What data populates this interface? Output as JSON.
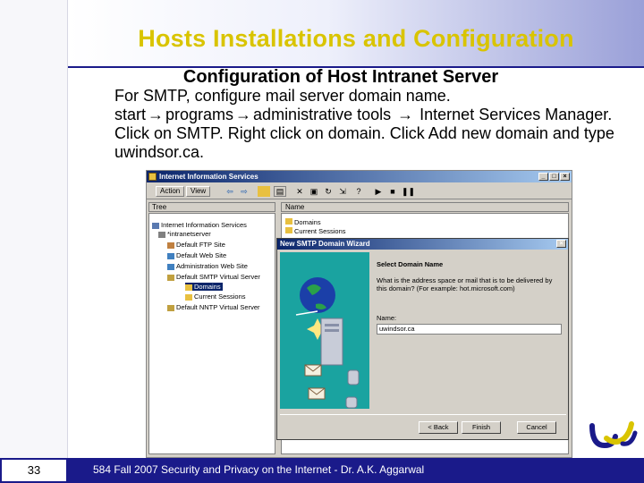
{
  "slide": {
    "title": "Hosts Installations and Configuration",
    "subtitle": "Configuration of Host Intranet Server",
    "body_line1": "For SMTP, configure mail server domain name.",
    "body_line2_a": "start",
    "body_line2_b": "programs",
    "body_line2_c": "administrative tools",
    "body_line2_d": "Internet Services Manager. Click on SMTP. Right click on domain. Click Add new domain and type uwindsor.ca.",
    "arrow_glyph": "→",
    "page_number": "33",
    "footer": "584  Fall 2007 Security and Privacy on the Internet - Dr. A.K. Aggarwal"
  },
  "window": {
    "title": "Internet Information Services",
    "menu_action": "Action",
    "menu_view": "View",
    "tree_tab": "Tree",
    "list_header": "Name",
    "tree_nodes": [
      "Internet Information Services",
      "*intranetserver",
      "Default FTP Site",
      "Default Web Site",
      "Administration Web Site",
      "Default SMTP Virtual Server",
      "Domains",
      "Current Sessions",
      "Default NNTP Virtual Server"
    ],
    "list_items": [
      "Domains",
      "Current Sessions"
    ]
  },
  "wizard": {
    "title": "New SMTP Domain Wizard",
    "heading": "Select Domain Name",
    "description": "What is the address space or mail that is to be delivered by this domain? (For example: hot.microsoft.com)",
    "name_label": "Name:",
    "name_value": "uwindsor.ca",
    "back_label": "< Back",
    "finish_label": "Finish",
    "cancel_label": "Cancel"
  },
  "colors": {
    "title": "#d9c400",
    "navy": "#1a1a8a",
    "titlebar": "#0a246a",
    "wizard_art": "#1aa3a0"
  }
}
